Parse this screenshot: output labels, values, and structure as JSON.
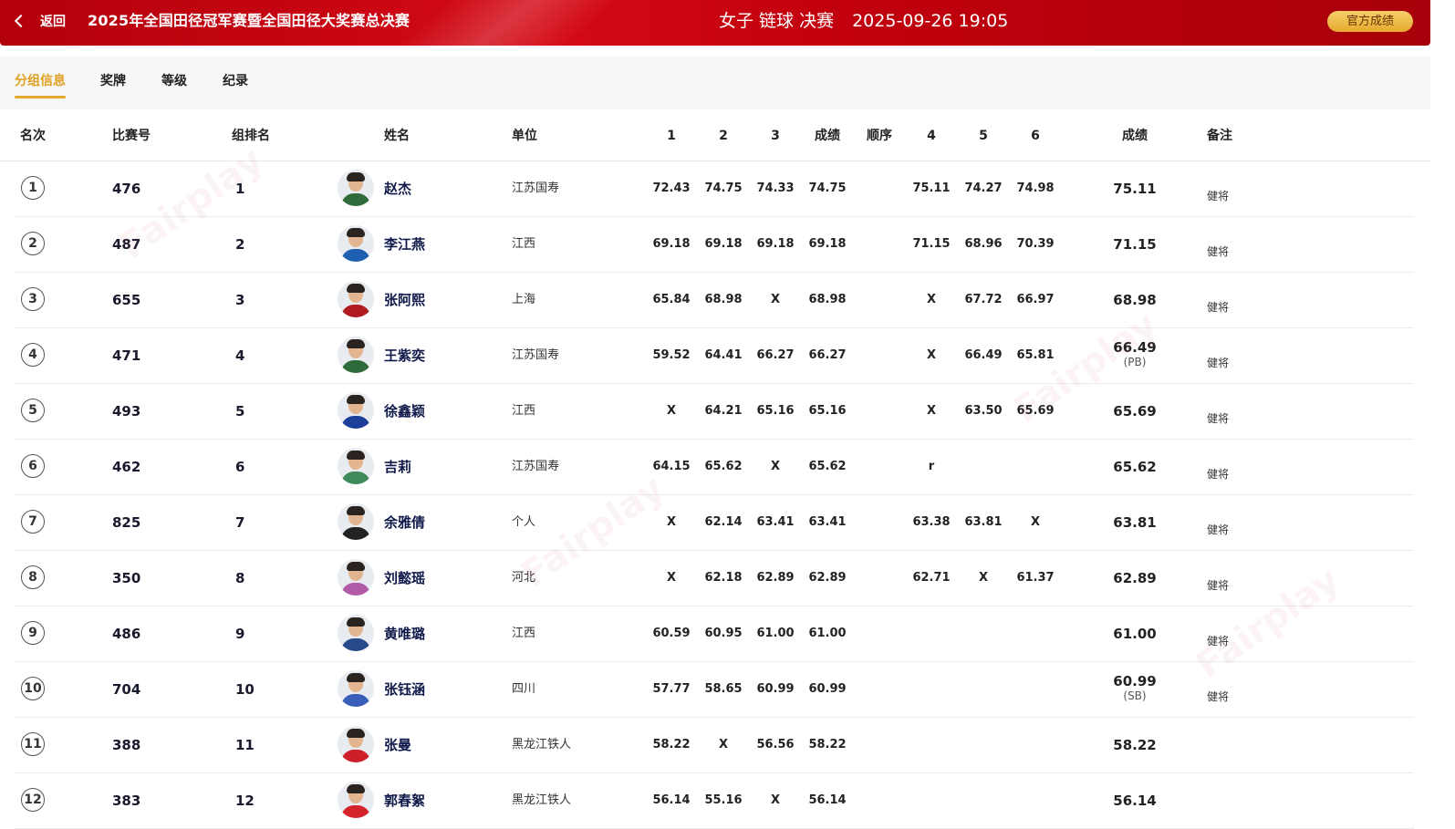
{
  "header": {
    "back_label": "返回",
    "title": "2025年全国田径冠军赛暨全国田径大奖赛总决赛",
    "event": "女子 链球 决赛",
    "datetime": "2025-09-26  19:05",
    "official_label": "官方成绩"
  },
  "tabs": [
    "分组信息",
    "奖牌",
    "等级",
    "纪录"
  ],
  "columns": {
    "rank": "名次",
    "bib": "比赛号",
    "group_rank": "组排名",
    "name": "姓名",
    "unit": "单位",
    "t1": "1",
    "t2": "2",
    "t3": "3",
    "best3": "成绩",
    "order": "顺序",
    "t4": "4",
    "t5": "5",
    "t6": "6",
    "result": "成绩",
    "note": "备注"
  },
  "rows": [
    {
      "rank": "1",
      "bib": "476",
      "group_rank": "1",
      "name": "赵杰",
      "unit": "江苏国寿",
      "t1": "72.43",
      "t2": "74.75",
      "t3": "74.33",
      "best3": "74.75",
      "t4": "75.11",
      "t5": "74.27",
      "t6": "74.98",
      "result": "75.11",
      "result_sub": "",
      "note": "健将"
    },
    {
      "rank": "2",
      "bib": "487",
      "group_rank": "2",
      "name": "李江燕",
      "unit": "江西",
      "t1": "69.18",
      "t2": "69.18",
      "t3": "69.18",
      "best3": "69.18",
      "t4": "71.15",
      "t5": "68.96",
      "t6": "70.39",
      "result": "71.15",
      "result_sub": "",
      "note": "健将"
    },
    {
      "rank": "3",
      "bib": "655",
      "group_rank": "3",
      "name": "张阿熙",
      "unit": "上海",
      "t1": "65.84",
      "t2": "68.98",
      "t3": "X",
      "best3": "68.98",
      "t4": "X",
      "t5": "67.72",
      "t6": "66.97",
      "result": "68.98",
      "result_sub": "",
      "note": "健将"
    },
    {
      "rank": "4",
      "bib": "471",
      "group_rank": "4",
      "name": "王紫奕",
      "unit": "江苏国寿",
      "t1": "59.52",
      "t2": "64.41",
      "t3": "66.27",
      "best3": "66.27",
      "t4": "X",
      "t5": "66.49",
      "t6": "65.81",
      "result": "66.49",
      "result_sub": "(PB)",
      "note": "健将"
    },
    {
      "rank": "5",
      "bib": "493",
      "group_rank": "5",
      "name": "徐鑫颖",
      "unit": "江西",
      "t1": "X",
      "t2": "64.21",
      "t3": "65.16",
      "best3": "65.16",
      "t4": "X",
      "t5": "63.50",
      "t6": "65.69",
      "result": "65.69",
      "result_sub": "",
      "note": "健将"
    },
    {
      "rank": "6",
      "bib": "462",
      "group_rank": "6",
      "name": "吉莉",
      "unit": "江苏国寿",
      "t1": "64.15",
      "t2": "65.62",
      "t3": "X",
      "best3": "65.62",
      "t4": "r",
      "t5": "",
      "t6": "",
      "result": "65.62",
      "result_sub": "",
      "note": "健将"
    },
    {
      "rank": "7",
      "bib": "825",
      "group_rank": "7",
      "name": "余雅倩",
      "unit": "个人",
      "t1": "X",
      "t2": "62.14",
      "t3": "63.41",
      "best3": "63.41",
      "t4": "63.38",
      "t5": "63.81",
      "t6": "X",
      "result": "63.81",
      "result_sub": "",
      "note": "健将"
    },
    {
      "rank": "8",
      "bib": "350",
      "group_rank": "8",
      "name": "刘懿瑶",
      "unit": "河北",
      "t1": "X",
      "t2": "62.18",
      "t3": "62.89",
      "best3": "62.89",
      "t4": "62.71",
      "t5": "X",
      "t6": "61.37",
      "result": "62.89",
      "result_sub": "",
      "note": "健将"
    },
    {
      "rank": "9",
      "bib": "486",
      "group_rank": "9",
      "name": "黄唯璐",
      "unit": "江西",
      "t1": "60.59",
      "t2": "60.95",
      "t3": "61.00",
      "best3": "61.00",
      "t4": "",
      "t5": "",
      "t6": "",
      "result": "61.00",
      "result_sub": "",
      "note": "健将"
    },
    {
      "rank": "10",
      "bib": "704",
      "group_rank": "10",
      "name": "张钰涵",
      "unit": "四川",
      "t1": "57.77",
      "t2": "58.65",
      "t3": "60.99",
      "best3": "60.99",
      "t4": "",
      "t5": "",
      "t6": "",
      "result": "60.99",
      "result_sub": "(SB)",
      "note": "健将"
    },
    {
      "rank": "11",
      "bib": "388",
      "group_rank": "11",
      "name": "张曼",
      "unit": "黑龙江铁人",
      "t1": "58.22",
      "t2": "X",
      "t3": "56.56",
      "best3": "58.22",
      "t4": "",
      "t5": "",
      "t6": "",
      "result": "58.22",
      "result_sub": "",
      "note": ""
    },
    {
      "rank": "12",
      "bib": "383",
      "group_rank": "12",
      "name": "郭春絮",
      "unit": "黑龙江铁人",
      "t1": "56.14",
      "t2": "55.16",
      "t3": "X",
      "best3": "56.14",
      "t4": "",
      "t5": "",
      "t6": "",
      "result": "56.14",
      "result_sub": "",
      "note": ""
    }
  ],
  "avatar_colors": [
    "#2f6b3a",
    "#1f5fb0",
    "#b01c22",
    "#2f6b3a",
    "#1d3f9a",
    "#3e8a5a",
    "#222222",
    "#b15aa8",
    "#274a8a",
    "#3a5fb8",
    "#cc1f2a",
    "#d4232b"
  ],
  "accent_color": "#e3a82c",
  "brand_red": "#c1000d"
}
